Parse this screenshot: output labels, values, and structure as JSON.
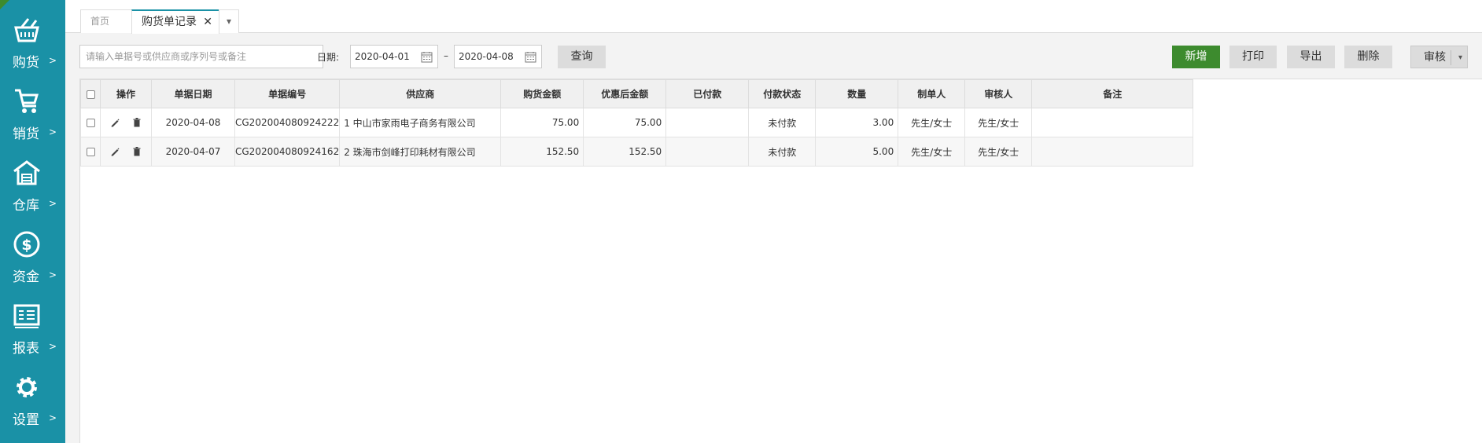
{
  "sidebar": {
    "items": [
      {
        "label": "购货",
        "arrow": ">",
        "icon": "basket-icon"
      },
      {
        "label": "销货",
        "arrow": ">",
        "icon": "cart-icon"
      },
      {
        "label": "仓库",
        "arrow": ">",
        "icon": "warehouse-icon"
      },
      {
        "label": "资金",
        "arrow": ">",
        "icon": "dollar-icon"
      },
      {
        "label": "报表",
        "arrow": ">",
        "icon": "report-icon"
      },
      {
        "label": "设置",
        "arrow": ">",
        "icon": "gear-icon"
      }
    ]
  },
  "tabs": {
    "home": "首页",
    "active": "购货单记录",
    "close": "✕",
    "more": "▾"
  },
  "toolbar": {
    "search_placeholder": "请输入单据号或供应商或序列号或备注",
    "date_label": "日期:",
    "date_from": "2020-04-01",
    "date_sep": "–",
    "date_to": "2020-04-08",
    "query": "查询",
    "add": "新增",
    "print": "打印",
    "export": "导出",
    "delete": "删除",
    "audit": "审核",
    "audit_caret": "▾"
  },
  "table": {
    "headers": [
      "操作",
      "单据日期",
      "单据编号",
      "供应商",
      "购货金额",
      "优惠后金额",
      "已付款",
      "付款状态",
      "数量",
      "制单人",
      "审核人",
      "备注"
    ],
    "rows": [
      {
        "date": "2020-04-08",
        "no": "CG202004080924222",
        "supplier": "1 中山市家雨电子商务有限公司",
        "amount": "75.00",
        "discounted": "75.00",
        "paid": "",
        "status": "未付款",
        "qty": "3.00",
        "maker": "先生/女士",
        "auditor": "先生/女士",
        "note": ""
      },
      {
        "date": "2020-04-07",
        "no": "CG202004080924162",
        "supplier": "2 珠海市剑峰打印耗材有限公司",
        "amount": "152.50",
        "discounted": "152.50",
        "paid": "",
        "status": "未付款",
        "qty": "5.00",
        "maker": "先生/女士",
        "auditor": "先生/女士",
        "note": ""
      }
    ]
  },
  "colors": {
    "sidebar": "#1a91a6",
    "primary_button": "#3d8b2e"
  }
}
